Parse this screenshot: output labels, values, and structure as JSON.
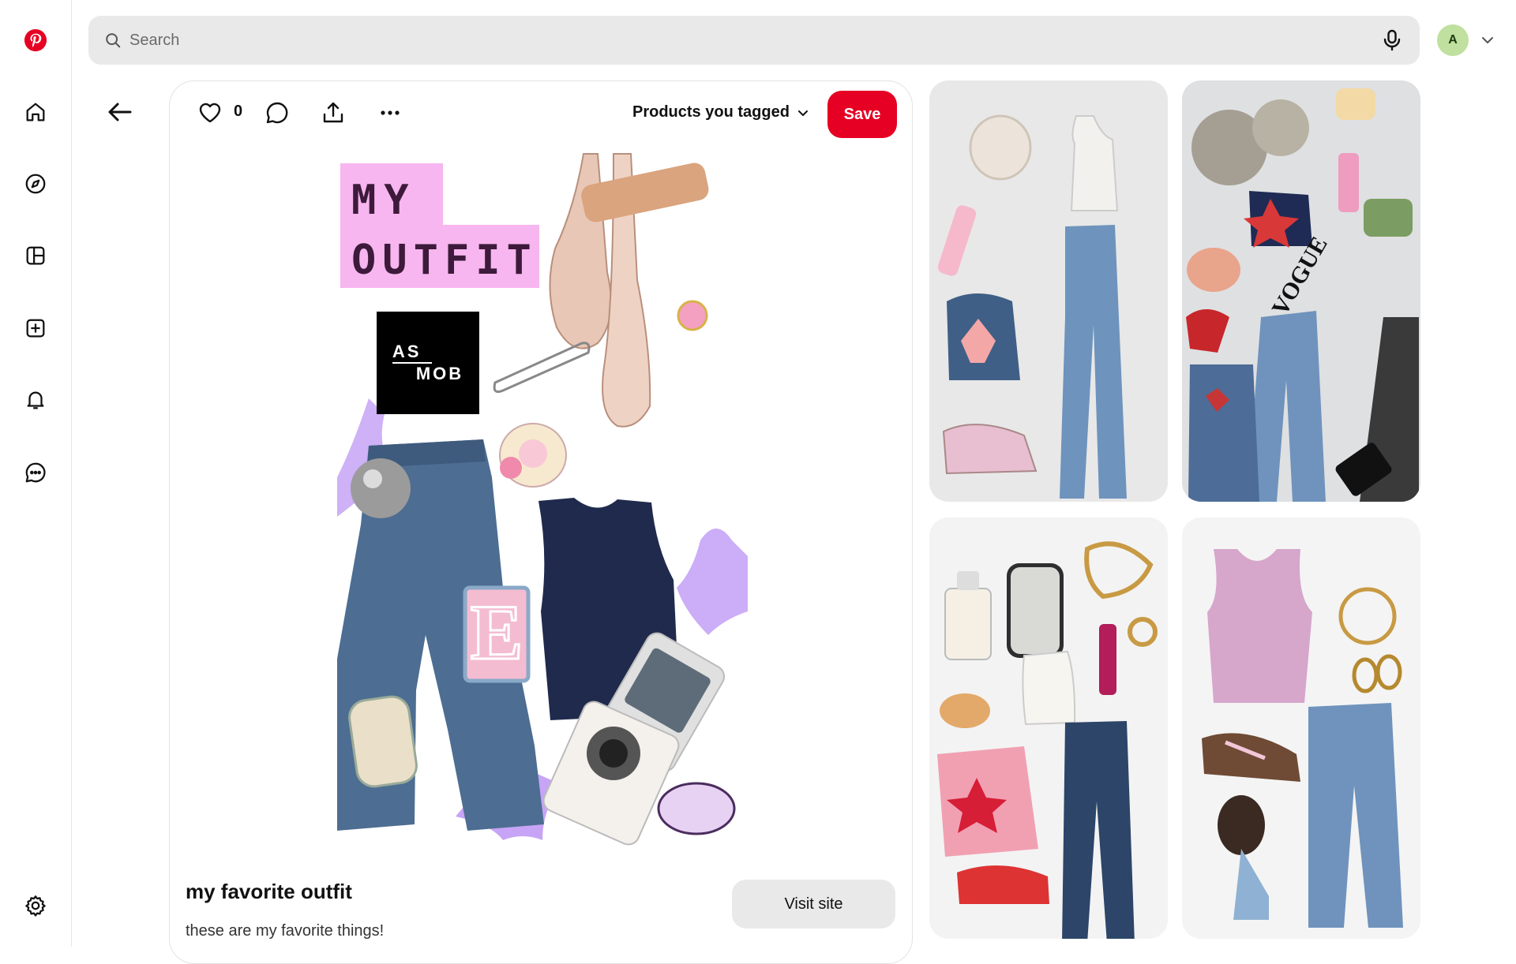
{
  "search": {
    "placeholder": "Search"
  },
  "account": {
    "initial": "A"
  },
  "pin": {
    "like_count": "0",
    "products_dropdown": "Products you tagged",
    "save_label": "Save",
    "title": "my favorite outfit",
    "description": "these are my favorite things!",
    "visit_label": "Visit site"
  },
  "collage": {
    "title_line1": "MY",
    "title_line2": "OUTFIT",
    "logo_text_top": "AS",
    "logo_text_bottom": "MOB"
  },
  "colors": {
    "brand": "#e60023",
    "search_bg": "#e9e9e9",
    "avatar_bg": "#bfe09e"
  },
  "related_pins": [
    {
      "icon": "outfit-collage-1"
    },
    {
      "icon": "outfit-collage-2"
    },
    {
      "icon": "outfit-collage-3"
    },
    {
      "icon": "outfit-collage-4"
    }
  ]
}
